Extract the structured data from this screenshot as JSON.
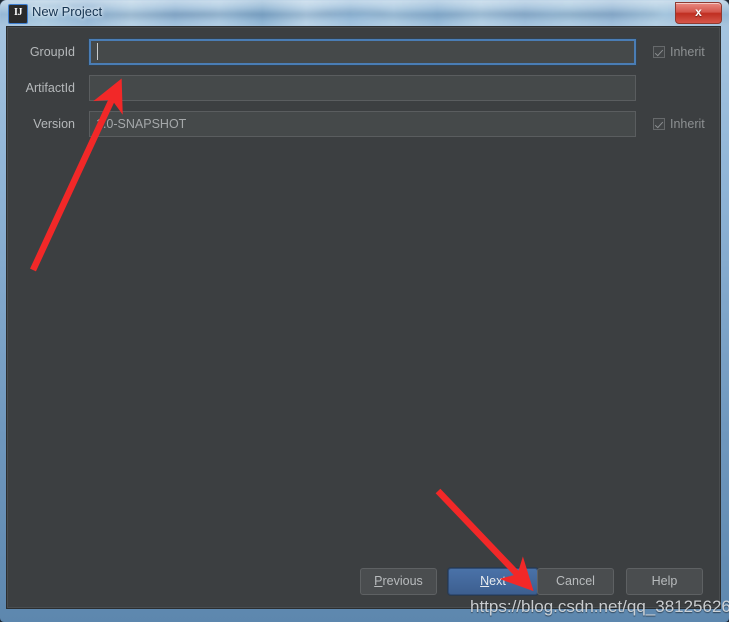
{
  "window": {
    "title": "New Project",
    "app_icon": "IJ",
    "close_label": "x"
  },
  "form": {
    "rows": [
      {
        "label": "GroupId",
        "value": "",
        "placeholder": "",
        "focused": true,
        "inherit_label": "Inherit",
        "inherit_checked": true,
        "has_inherit": true
      },
      {
        "label": "ArtifactId",
        "value": "",
        "placeholder": "",
        "focused": false,
        "inherit_label": "",
        "inherit_checked": false,
        "has_inherit": false
      },
      {
        "label": "Version",
        "value": "1.0-SNAPSHOT",
        "placeholder": "",
        "focused": false,
        "inherit_label": "Inherit",
        "inherit_checked": true,
        "has_inherit": true
      }
    ]
  },
  "buttons": {
    "previous": {
      "label": "Previous",
      "mnemonic": "P",
      "rest": "revious"
    },
    "next": {
      "label": "Next",
      "mnemonic": "N",
      "rest": "ext"
    },
    "cancel": {
      "label": "Cancel"
    },
    "help": {
      "label": "Help"
    }
  },
  "annotations": {
    "arrow_color": "#f22828",
    "arrow_1_target": "ArtifactId field",
    "arrow_2_target": "Next button"
  },
  "watermark": {
    "text": "https://blog.csdn.net/qq_38125626"
  },
  "colors": {
    "dialog_background": "#3c3f41",
    "field_background": "#45494a",
    "focus_border": "#4a7db5",
    "default_button": "#3d5f90",
    "close_button": "#bf2e21",
    "arrow_red": "#f22828"
  }
}
